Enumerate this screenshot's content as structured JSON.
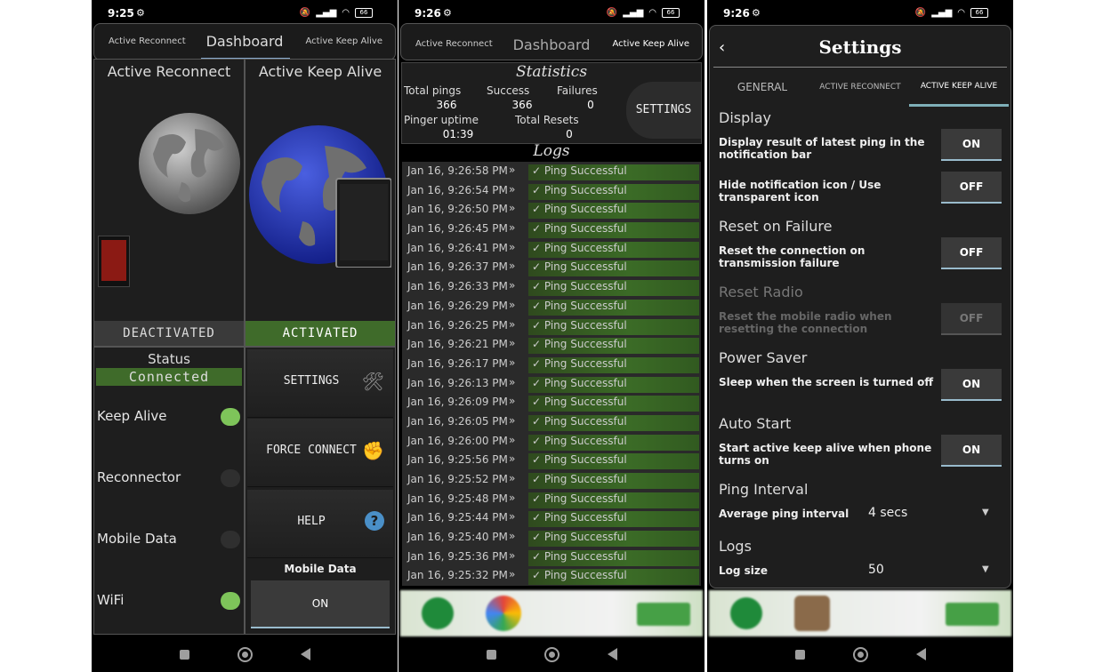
{
  "status_bar": {
    "p1_time": "9:25",
    "p2_time": "9:26",
    "p3_time": "9:26",
    "battery": "66"
  },
  "dashboard": {
    "tab_left": "Active Reconnect",
    "tab_center": "Dashboard",
    "tab_right": "Active Keep Alive",
    "reconnect_title": "Active Reconnect",
    "reconnect_state": "DEACTIVATED",
    "keepalive_title": "Active Keep Alive",
    "keepalive_state": "ACTIVATED",
    "status_label": "Status",
    "status_value": "Connected",
    "toggles": [
      {
        "label": "Keep Alive",
        "on": true
      },
      {
        "label": "Reconnector",
        "on": false
      },
      {
        "label": "Mobile Data",
        "on": false
      },
      {
        "label": "WiFi",
        "on": true
      }
    ],
    "buttons": {
      "settings": "SETTINGS",
      "force_connect": "FORCE CONNECT",
      "help": "HELP"
    },
    "mobile_data_label": "Mobile Data",
    "mobile_data_button": "ON",
    "colors": {
      "accent_green": "#7ec45a",
      "activated_bg": "#3f6b2a"
    }
  },
  "keepalive_page": {
    "tab_left": "Active Reconnect",
    "tab_center": "Dashboard",
    "tab_right": "Active Keep Alive",
    "statistics_header": "Statistics",
    "total_pings_label": "Total pings",
    "total_pings": "366",
    "success_label": "Success",
    "success": "366",
    "failures_label": "Failures",
    "failures": "0",
    "uptime_label": "Pinger uptime",
    "uptime": "01:39",
    "resets_label": "Total Resets",
    "resets": "0",
    "settings_button": "SETTINGS",
    "logs_header": "Logs",
    "log_rows": [
      {
        "time": "Jan 16, 9:26:58 PM",
        "result": "✓ Ping Successful"
      },
      {
        "time": "Jan 16, 9:26:54 PM",
        "result": "✓ Ping Successful"
      },
      {
        "time": "Jan 16, 9:26:50 PM",
        "result": "✓ Ping Successful"
      },
      {
        "time": "Jan 16, 9:26:45 PM",
        "result": "✓ Ping Successful"
      },
      {
        "time": "Jan 16, 9:26:41 PM",
        "result": "✓ Ping Successful"
      },
      {
        "time": "Jan 16, 9:26:37 PM",
        "result": "✓ Ping Successful"
      },
      {
        "time": "Jan 16, 9:26:33 PM",
        "result": "✓ Ping Successful"
      },
      {
        "time": "Jan 16, 9:26:29 PM",
        "result": "✓ Ping Successful"
      },
      {
        "time": "Jan 16, 9:26:25 PM",
        "result": "✓ Ping Successful"
      },
      {
        "time": "Jan 16, 9:26:21 PM",
        "result": "✓ Ping Successful"
      },
      {
        "time": "Jan 16, 9:26:17 PM",
        "result": "✓ Ping Successful"
      },
      {
        "time": "Jan 16, 9:26:13 PM",
        "result": "✓ Ping Successful"
      },
      {
        "time": "Jan 16, 9:26:09 PM",
        "result": "✓ Ping Successful"
      },
      {
        "time": "Jan 16, 9:26:05 PM",
        "result": "✓ Ping Successful"
      },
      {
        "time": "Jan 16, 9:26:00 PM",
        "result": "✓ Ping Successful"
      },
      {
        "time": "Jan 16, 9:25:56 PM",
        "result": "✓ Ping Successful"
      },
      {
        "time": "Jan 16, 9:25:52 PM",
        "result": "✓ Ping Successful"
      },
      {
        "time": "Jan 16, 9:25:48 PM",
        "result": "✓ Ping Successful"
      },
      {
        "time": "Jan 16, 9:25:44 PM",
        "result": "✓ Ping Successful"
      },
      {
        "time": "Jan 16, 9:25:40 PM",
        "result": "✓ Ping Successful"
      },
      {
        "time": "Jan 16, 9:25:36 PM",
        "result": "✓ Ping Successful"
      },
      {
        "time": "Jan 16, 9:25:32 PM",
        "result": "✓ Ping Successful"
      }
    ]
  },
  "settings": {
    "title": "Settings",
    "tabs": [
      "GENERAL",
      "ACTIVE RECONNECT",
      "ACTIVE KEEP ALIVE"
    ],
    "sections": [
      {
        "title": "Display",
        "items": [
          {
            "label": "Display result of latest ping in the notification bar",
            "value": "ON",
            "disabled": false
          },
          {
            "label": "Hide notification icon / Use transparent icon",
            "value": "OFF",
            "disabled": false
          }
        ]
      },
      {
        "title": "Reset on Failure",
        "items": [
          {
            "label": "Reset the connection on transmission failure",
            "value": "OFF",
            "disabled": false
          }
        ]
      },
      {
        "title": "Reset Radio",
        "items": [
          {
            "label": "Reset the mobile radio when resetting the connection",
            "value": "OFF",
            "disabled": true
          }
        ]
      },
      {
        "title": "Power Saver",
        "items": [
          {
            "label": "Sleep when the screen is turned off",
            "value": "ON",
            "disabled": false
          }
        ]
      },
      {
        "title": "Auto Start",
        "items": [
          {
            "label": "Start active keep alive when phone turns on",
            "value": "ON",
            "disabled": false
          }
        ]
      },
      {
        "title": "Ping Interval",
        "items": [
          {
            "label": "Average ping interval",
            "value": "4 secs",
            "dropdown": true
          }
        ]
      },
      {
        "title": "Logs",
        "items": [
          {
            "label": "Log size",
            "value": "50",
            "dropdown": true
          }
        ]
      }
    ]
  }
}
